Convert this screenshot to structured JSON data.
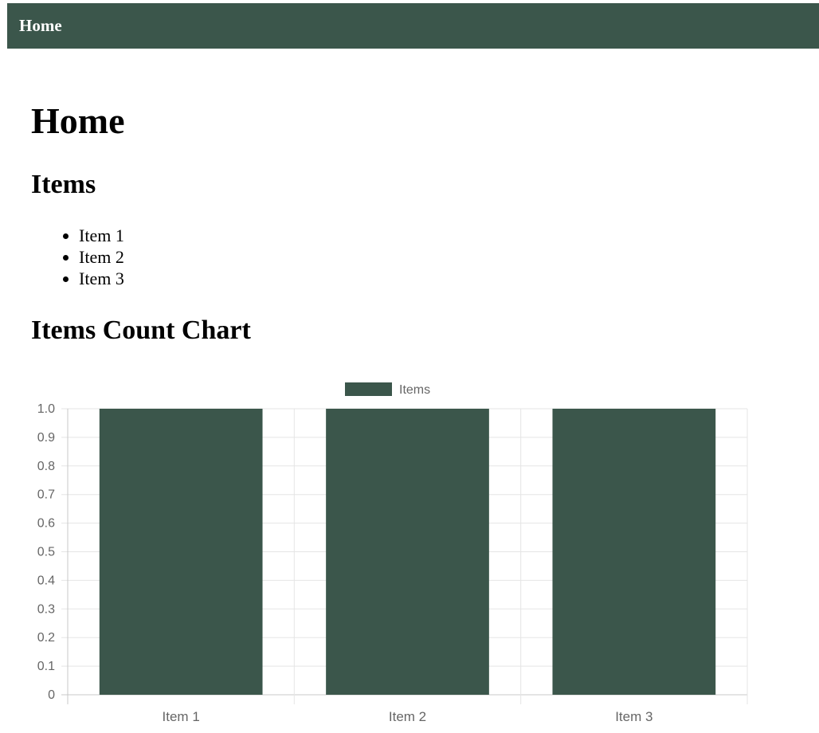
{
  "navbar": {
    "home_link": "Home"
  },
  "main": {
    "title": "Home",
    "items_heading": "Items",
    "items": [
      "Item 1",
      "Item 2",
      "Item 3"
    ],
    "chart_heading": "Items Count Chart"
  },
  "colors": {
    "brand": "#3b564b",
    "grid": "#e5e5e5",
    "axis_text": "#666666"
  },
  "chart_data": {
    "type": "bar",
    "categories": [
      "Item 1",
      "Item 2",
      "Item 3"
    ],
    "series": [
      {
        "name": "Items",
        "values": [
          1,
          1,
          1
        ]
      }
    ],
    "ylim": [
      0,
      1.0
    ],
    "yticks": [
      "0",
      "0.1",
      "0.2",
      "0.3",
      "0.4",
      "0.5",
      "0.6",
      "0.7",
      "0.8",
      "0.9",
      "1.0"
    ],
    "grid": true,
    "legend": "top-center"
  }
}
